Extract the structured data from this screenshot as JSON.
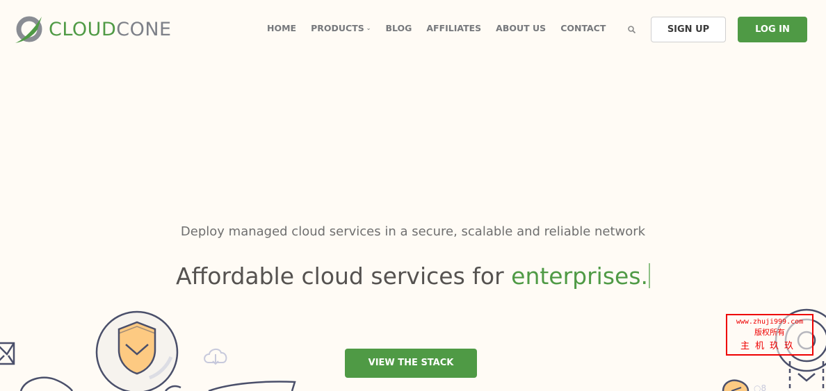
{
  "header": {
    "logo": {
      "part1": "CLOUD",
      "part2": "CONE"
    },
    "nav": [
      {
        "label": "HOME"
      },
      {
        "label": "PRODUCTS",
        "has_dropdown": true
      },
      {
        "label": "BLOG"
      },
      {
        "label": "AFFILIATES"
      },
      {
        "label": "ABOUT US"
      },
      {
        "label": "CONTACT"
      }
    ],
    "search_icon": "search-icon",
    "signup_label": "SIGN UP",
    "login_label": "LOG IN"
  },
  "hero": {
    "subtitle": "Deploy managed cloud services in a secure, scalable and reliable network",
    "headline_prefix": "Affordable cloud services for ",
    "headline_accent": "enterprises.",
    "cta_label": "VIEW THE STACK"
  },
  "watermark": {
    "line1": "www.zhuji999.com",
    "line2": "版权所有",
    "line3": "主机玖玖"
  },
  "colors": {
    "brand_green": "#4f9a45",
    "background": "#fffbf5",
    "nav_text": "#76787c",
    "illustration_stroke": "#4a4f6a",
    "shield_fill": "#fdca82"
  }
}
